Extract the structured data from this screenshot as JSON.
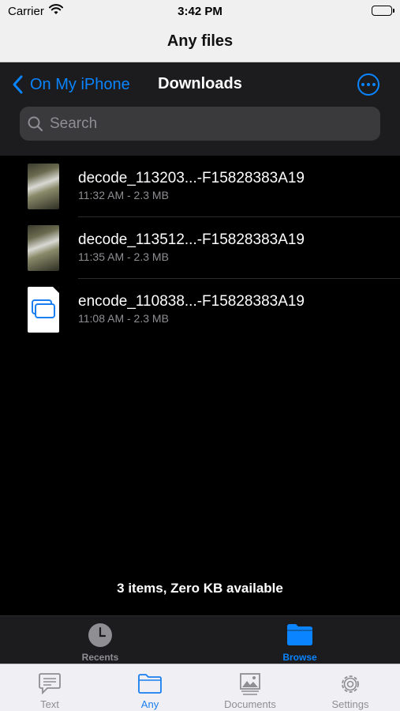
{
  "status_bar": {
    "carrier": "Carrier",
    "time": "3:42 PM"
  },
  "app": {
    "title": "Any files"
  },
  "nav": {
    "back_label": "On My iPhone",
    "title": "Downloads"
  },
  "search": {
    "placeholder": "Search"
  },
  "files": [
    {
      "name": "decode_113203...-F15828383A19",
      "meta": "11:32 AM - 2.3 MB",
      "thumb": "photo"
    },
    {
      "name": "decode_113512...-F15828383A19",
      "meta": "11:35 AM - 2.3 MB",
      "thumb": "photo"
    },
    {
      "name": "encode_110838...-F15828383A19",
      "meta": "11:08 AM - 2.3 MB",
      "thumb": "document"
    }
  ],
  "footer": {
    "summary": "3 items, Zero KB available"
  },
  "inner_tabs": [
    {
      "label": "Recents",
      "icon": "clock-icon",
      "active": false
    },
    {
      "label": "Browse",
      "icon": "folder-icon",
      "active": true
    }
  ],
  "outer_tabs": [
    {
      "label": "Text",
      "icon": "chat-bubble-icon",
      "active": false
    },
    {
      "label": "Any",
      "icon": "folder-icon",
      "active": true
    },
    {
      "label": "Documents",
      "icon": "image-stack-icon",
      "active": false
    },
    {
      "label": "Settings",
      "icon": "gear-icon",
      "active": false
    }
  ],
  "colors": {
    "accent": "#0a84ff",
    "outer_active": "#1a7ff0",
    "inactive": "#8e8e93",
    "nav_bg": "#1c1c1e"
  }
}
